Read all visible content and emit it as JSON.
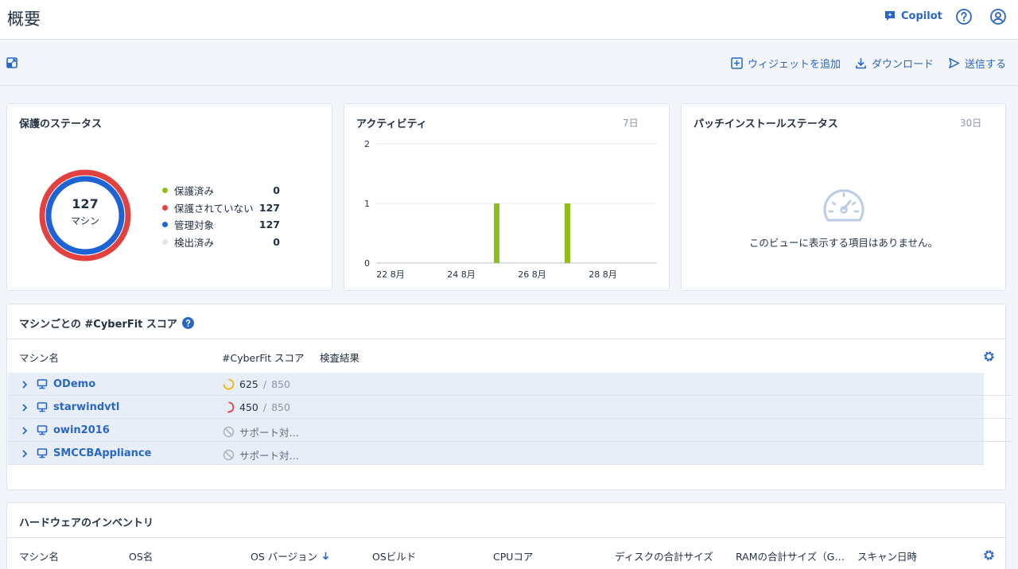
{
  "page": {
    "title": "概要"
  },
  "header": {
    "copilot_label": "Copilot"
  },
  "toolbar": {
    "add_widget": "ウィジェットを追加",
    "download": "ダウンロード",
    "send": "送信する"
  },
  "protection": {
    "title": "保護のステータス",
    "total": "127",
    "total_label": "マシン",
    "legend": [
      {
        "label": "保護済み",
        "value": "0",
        "color": "#8fbf1d"
      },
      {
        "label": "保護されていない",
        "value": "127",
        "color": "#e34040"
      },
      {
        "label": "管理対象",
        "value": "127",
        "color": "#1e63d6"
      },
      {
        "label": "検出済み",
        "value": "0",
        "color": "#dfe4ea"
      }
    ]
  },
  "activity": {
    "title": "アクティビティ",
    "period": "7日"
  },
  "chart_data": {
    "type": "bar",
    "title": "アクティビティ",
    "x": [
      "22 8月",
      "23 8月",
      "24 8月",
      "25 8月",
      "26 8月",
      "27 8月",
      "28 8月"
    ],
    "x_tick_labels": [
      "22 8月",
      "24 8月",
      "26 8月",
      "28 8月"
    ],
    "values": [
      0,
      0,
      0,
      1,
      0,
      1,
      0
    ],
    "ylim": [
      0,
      2
    ],
    "y_ticks": [
      "0",
      "1",
      "2"
    ],
    "color": "#8fbf1d",
    "grid": true
  },
  "patch": {
    "title": "パッチインストールステータス",
    "period": "30日",
    "empty_message": "このビューに表示する項目はありません。"
  },
  "cyberfit": {
    "title": "マシンごとの #CyberFit スコア",
    "columns": {
      "name": "マシン名",
      "score": "#CyberFit スコア",
      "result": "検査結果"
    },
    "rows": [
      {
        "name": "ODemo",
        "score": "625",
        "max": "850",
        "status": "score",
        "ring_color": "#f2b705",
        "ring_fraction": 0.74
      },
      {
        "name": "starwindvtl",
        "score": "450",
        "max": "850",
        "status": "score",
        "ring_color": "#e34040",
        "ring_fraction": 0.53
      },
      {
        "name": "owin2016",
        "score": "サポート対…",
        "status": "unsupported"
      },
      {
        "name": "SMCCBAppliance",
        "score": "サポート対…",
        "status": "unsupported"
      }
    ]
  },
  "hardware": {
    "title": "ハードウェアのインベントリ",
    "columns": [
      "マシン名",
      "OS名",
      "OS バージョン",
      "OSビルド",
      "CPUコア",
      "ディスクの合計サイズ",
      "RAMの合計サイズ（G…",
      "スキャン日時"
    ]
  }
}
